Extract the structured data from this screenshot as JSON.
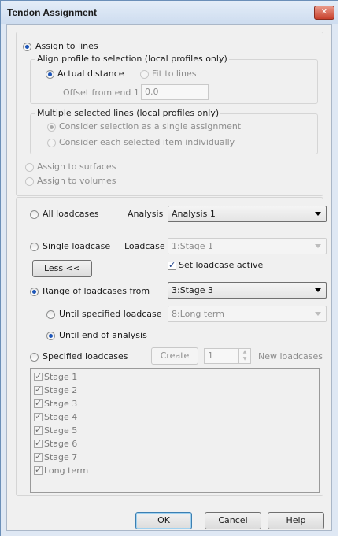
{
  "window": {
    "title": "Tendon Assignment",
    "close_label": "✕"
  },
  "assign": {
    "to_lines": "Assign to lines",
    "align_group": "Align profile to selection (local profiles only)",
    "actual_distance": "Actual distance",
    "fit_to_lines": "Fit to lines",
    "offset_label": "Offset from end 1",
    "offset_value": "0.0",
    "multiple_group": "Multiple selected lines (local profiles only)",
    "single_assignment": "Consider selection as a single assignment",
    "individually": "Consider each selected item individually",
    "to_surfaces": "Assign to surfaces",
    "to_volumes": "Assign to volumes"
  },
  "loadcases": {
    "all": "All loadcases",
    "analysis_label": "Analysis",
    "analysis_value": "Analysis 1",
    "single": "Single loadcase",
    "loadcase_label": "Loadcase",
    "loadcase_value": "1:Stage 1",
    "less_button": "Less <<",
    "set_active": "Set loadcase active",
    "range_from": "Range of loadcases from",
    "range_value": "3:Stage 3",
    "until_specified": "Until specified loadcase",
    "until_value": "8:Long term",
    "until_end": "Until end of analysis",
    "specified": "Specified loadcases",
    "create_button": "Create",
    "create_count": "1",
    "new_loadcases": "New loadcases",
    "items": [
      "Stage 1",
      "Stage 2",
      "Stage 3",
      "Stage 4",
      "Stage 5",
      "Stage 6",
      "Stage 7",
      "Long term"
    ]
  },
  "footer": {
    "ok": "OK",
    "cancel": "Cancel",
    "help": "Help"
  }
}
